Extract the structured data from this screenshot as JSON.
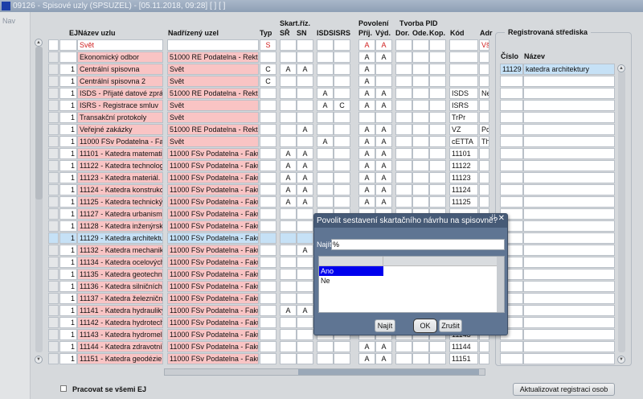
{
  "window": {
    "title": "09126 - Spisové uzly (SPSUZEL) - [05.11.2018, 09:28]  [ ]  [ ]",
    "logo": "F"
  },
  "nav": {
    "label": "Nav"
  },
  "headers": {
    "skart": "Skart.říz.",
    "povoleni": "Povolení",
    "tvorba": "Tvorba PID",
    "ej": "EJ",
    "name": "Název uzlu",
    "parent": "Nadřízený uzel",
    "typ": "Typ",
    "sr": "SŘ",
    "sn": "SN",
    "isds": "ISDS",
    "isrs": "ISRS",
    "prij": "Příj.",
    "vyd": "Výd.",
    "dor": "Dor.",
    "ode": "Ode.",
    "kop": "Kop.",
    "kod": "Kód",
    "adr": "Adr"
  },
  "rows": [
    [
      "",
      "Svět",
      "",
      "S",
      "",
      "",
      "",
      "",
      "A",
      "A",
      "",
      "",
      "",
      "",
      "Vše"
    ],
    [
      "",
      "Ekonomický odbor",
      "51000 RE Podatelna - Rektorát",
      "",
      "",
      "",
      "",
      "",
      "A",
      "A",
      "",
      "",
      "",
      "",
      ""
    ],
    [
      "1",
      "Centrální spisovna",
      "Svět",
      "C",
      "A",
      "A",
      "",
      "",
      "A",
      "",
      "",
      "",
      "",
      "",
      ""
    ],
    [
      "1",
      "Centrální spisovna 2",
      "Svět",
      "C",
      "",
      "",
      "",
      "",
      "A",
      "",
      "",
      "",
      "",
      "",
      ""
    ],
    [
      "1",
      "ISDS - Přijaté datové zprávy",
      "51000 RE Podatelna - Rektorát",
      "",
      "",
      "",
      "A",
      "",
      "A",
      "A",
      "",
      "",
      "",
      "ISDS",
      "Ne"
    ],
    [
      "1",
      "ISRS - Registrace smluv",
      "Svět",
      "",
      "",
      "",
      "A",
      "C",
      "A",
      "A",
      "",
      "",
      "",
      "ISRS",
      ""
    ],
    [
      "1",
      "Transakční protokoly",
      "Svět",
      "",
      "",
      "",
      "",
      "",
      "",
      "",
      "",
      "",
      "",
      "TrPr",
      ""
    ],
    [
      "1",
      "Veřejné zakázky",
      "51000 RE Podatelna - Rektorát",
      "",
      "",
      "A",
      "",
      "",
      "A",
      "A",
      "",
      "",
      "",
      "VZ",
      "Po"
    ],
    [
      "1",
      "11000 FSv Podatelna - Fakulta",
      "Svět",
      "",
      "",
      "",
      "A",
      "",
      "A",
      "A",
      "",
      "",
      "",
      "cETTA",
      "Th"
    ],
    [
      "1",
      "11101 - Katedra matematiky",
      "11000 FSv Podatelna - Fakulta",
      "",
      "A",
      "A",
      "",
      "",
      "A",
      "A",
      "",
      "",
      "",
      "11101",
      ""
    ],
    [
      "1",
      "11122 - Katedra technologie",
      "11000 FSv Podatelna - Fakulta",
      "",
      "A",
      "A",
      "",
      "",
      "A",
      "A",
      "",
      "",
      "",
      "11122",
      ""
    ],
    [
      "1",
      "11123 - Katedra materiál. inženýrství",
      "11000 FSv Podatelna - Fakulta",
      "",
      "A",
      "A",
      "",
      "",
      "A",
      "A",
      "",
      "",
      "",
      "11123",
      ""
    ],
    [
      "1",
      "11124 - Katedra konstrukcí",
      "11000 FSv Podatelna - Fakulta",
      "",
      "A",
      "A",
      "",
      "",
      "A",
      "A",
      "",
      "",
      "",
      "11124",
      ""
    ],
    [
      "1",
      "11125 - Katedra technických",
      "11000 FSv Podatelna - Fakulta",
      "",
      "A",
      "A",
      "",
      "",
      "A",
      "A",
      "",
      "",
      "",
      "11125",
      ""
    ],
    [
      "1",
      "11127 - Katedra urbanismu",
      "11000 FSv Podatelna - Fakulta",
      "",
      "",
      "",
      "",
      "",
      "",
      "",
      "",
      "",
      "",
      "",
      ""
    ],
    [
      "1",
      "11128 - Katedra inženýrské",
      "11000 FSv Podatelna - Fakulta",
      "",
      "",
      "",
      "",
      "",
      "",
      "",
      "",
      "",
      "",
      "",
      ""
    ],
    [
      "1",
      "11129 - Katedra architektury",
      "11000 FSv Podatelna - Fakulta",
      "",
      "",
      "",
      "",
      "",
      "",
      "",
      "",
      "",
      "",
      "",
      ""
    ],
    [
      "1",
      "11132 - Katedra mechaniky",
      "11000 FSv Podatelna - Fakulta",
      "",
      "",
      "A",
      "",
      "",
      "",
      "",
      "",
      "",
      "",
      "",
      ""
    ],
    [
      "1",
      "11134 - Katedra ocelových",
      "11000 FSv Podatelna - Fakulta",
      "",
      "",
      "",
      "",
      "",
      "",
      "",
      "",
      "",
      "",
      "",
      ""
    ],
    [
      "1",
      "11135 - Katedra geotechniky",
      "11000 FSv Podatelna - Fakulta",
      "",
      "",
      "",
      "",
      "",
      "",
      "",
      "",
      "",
      "",
      "",
      ""
    ],
    [
      "1",
      "11136 - Katedra silničních staveb",
      "11000 FSv Podatelna - Fakulta",
      "",
      "",
      "",
      "",
      "",
      "",
      "",
      "",
      "",
      "",
      "",
      ""
    ],
    [
      "1",
      "11137 - Katedra železničních",
      "11000 FSv Podatelna - Fakulta",
      "",
      "",
      "",
      "",
      "",
      "",
      "",
      "",
      "",
      "",
      "",
      ""
    ],
    [
      "1",
      "11141 - Katedra hydrauliky",
      "11000 FSv Podatelna - Fakulta",
      "",
      "A",
      "A",
      "",
      "",
      "",
      "",
      "",
      "",
      "",
      "",
      ""
    ],
    [
      "1",
      "11142 - Katedra hydrotechniky",
      "11000 FSv Podatelna - Fakulta",
      "",
      "",
      "",
      "",
      "",
      "",
      "",
      "",
      "",
      "",
      "",
      ""
    ],
    [
      "1",
      "11143 - Katedra hydromeliorací",
      "11000 FSv Podatelna - Fakulta",
      "",
      "",
      "",
      "",
      "",
      "",
      "",
      "",
      "",
      "",
      "11143",
      ""
    ],
    [
      "1",
      "11144 - Katedra zdravotního",
      "11000 FSv Podatelna - Fakulta",
      "",
      "",
      "",
      "",
      "",
      "A",
      "A",
      "",
      "",
      "",
      "11144",
      ""
    ],
    [
      "1",
      "11151 - Katedra geodézie a",
      "11000 FSv Podatelna - Fakulta",
      "",
      "",
      "",
      "",
      "",
      "A",
      "A",
      "",
      "",
      "",
      "11151",
      ""
    ]
  ],
  "selected_row": 16,
  "registered": {
    "title": "Registrovaná střediska",
    "col_cislo": "Číslo",
    "col_nazev": "Název",
    "rows": [
      [
        "11129",
        "katedra architektury"
      ]
    ]
  },
  "footer": {
    "all_ej_label": "Pracovat se všemi EJ",
    "all_ej_checked": false,
    "update_button": "Aktualizovat registraci osob"
  },
  "dialog": {
    "title": "Povolit sestavení skartačního návrhu na spisovně?",
    "find_label": "Najít",
    "find_value": "%",
    "options": [
      "Ano",
      "Ne"
    ],
    "selected_option": "Ano",
    "find_button": "Najít",
    "ok_button": "OK",
    "cancel_button": "Zrušit"
  },
  "colors": {
    "pink": "#f9c4c4",
    "selected": "#c6e1f6",
    "red": "#d02020",
    "dialog": "#5f7593",
    "list_selected": "#0000ee"
  }
}
